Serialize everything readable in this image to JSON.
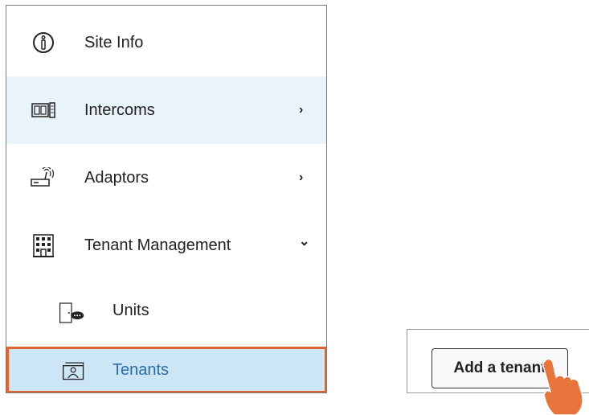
{
  "sidebar": {
    "items": [
      {
        "label": "Site Info",
        "icon": "info-icon"
      },
      {
        "label": "Intercoms",
        "icon": "intercom-icon",
        "chevron": "›"
      },
      {
        "label": "Adaptors",
        "icon": "adaptor-icon",
        "chevron": "›"
      },
      {
        "label": "Tenant Management",
        "icon": "building-icon",
        "chevron": "⌄"
      }
    ],
    "subitems": [
      {
        "label": "Units",
        "icon": "door-icon"
      },
      {
        "label": "Tenants",
        "icon": "tenant-card-icon"
      }
    ]
  },
  "panel": {
    "add_button_label": "Add a tenant",
    "cursor_icon": "hand-pointer-icon"
  },
  "colors": {
    "highlight_bg": "#e8f3fa",
    "selected_bg": "#cde6f5",
    "selected_border": "#e2642d",
    "selected_text": "#2a6ca8",
    "cursor_fill": "#e8743b"
  }
}
